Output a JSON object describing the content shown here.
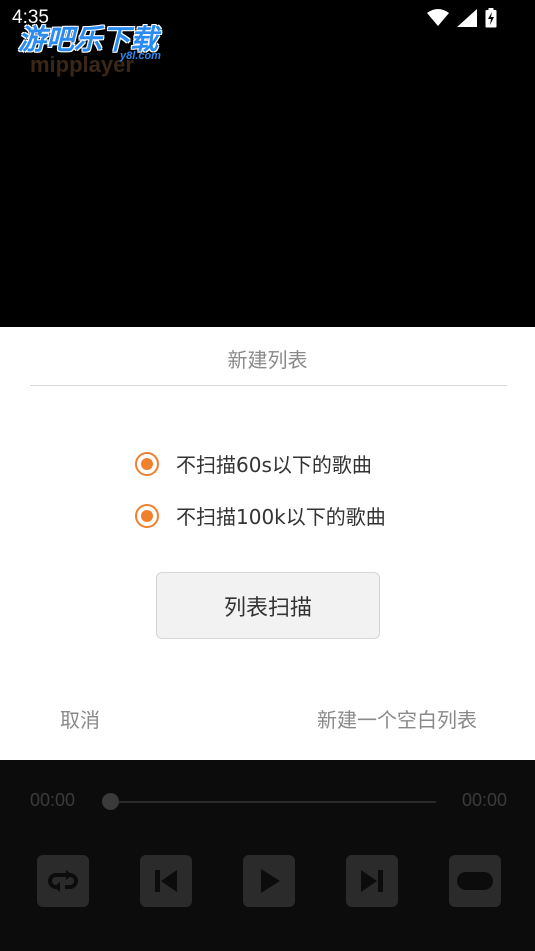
{
  "status_bar": {
    "time": "4:35"
  },
  "watermark": {
    "main": "游吧乐下载",
    "sub": "y8l.com"
  },
  "app": {
    "name": "mipplayer"
  },
  "dialog": {
    "title": "新建列表",
    "options": [
      {
        "label": "不扫描60s以下的歌曲",
        "checked": true
      },
      {
        "label": "不扫描100k以下的歌曲",
        "checked": true
      }
    ],
    "scan_button": "列表扫描",
    "cancel": "取消",
    "new_empty": "新建一个空白列表"
  },
  "player": {
    "current_time": "00:00",
    "total_time": "00:00",
    "progress": 0,
    "controls": [
      {
        "name": "repeat-icon"
      },
      {
        "name": "previous-icon"
      },
      {
        "name": "play-icon"
      },
      {
        "name": "next-icon"
      },
      {
        "name": "playlist-icon"
      }
    ]
  },
  "colors": {
    "accent": "#f07f2e",
    "dialog_bg": "#ffffff",
    "background": "#000000",
    "muted_text": "#8a8a8a"
  }
}
